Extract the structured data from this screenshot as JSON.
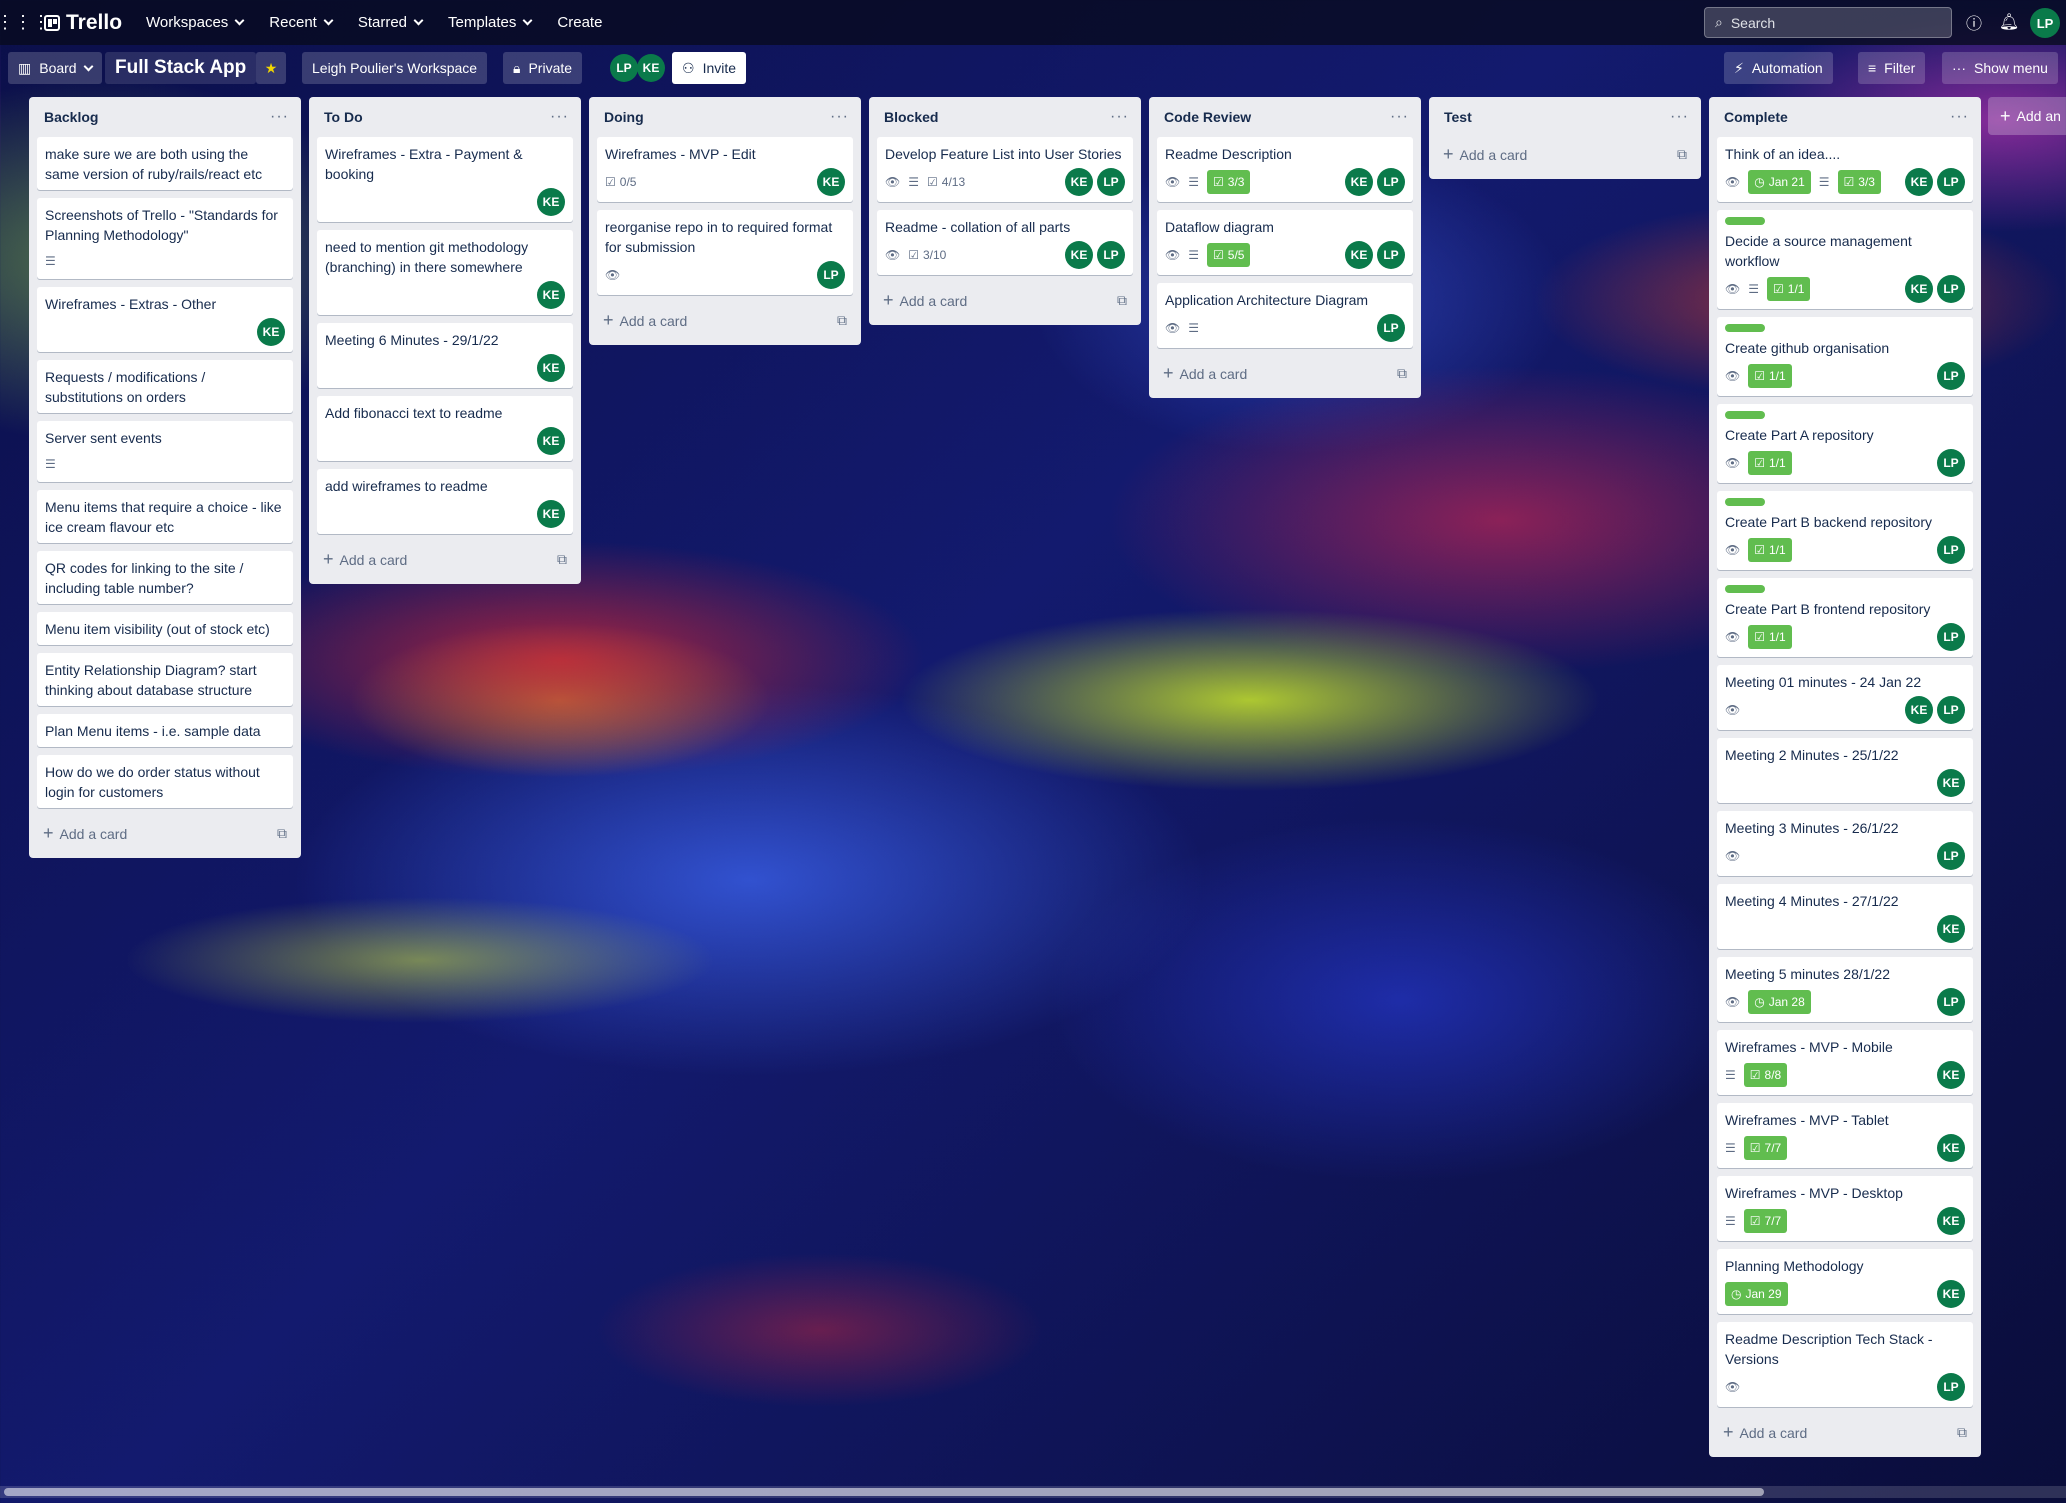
{
  "topbar": {
    "app_name": "Trello",
    "nav": [
      "Workspaces",
      "Recent",
      "Starred",
      "Templates"
    ],
    "create_label": "Create",
    "search_placeholder": "Search",
    "user_initials": "LP"
  },
  "board": {
    "view_label": "Board",
    "title": "Full Stack App",
    "workspace": "Leigh Poulier's Workspace",
    "visibility": "Private",
    "members": [
      "LP",
      "KE"
    ],
    "invite_label": "Invite",
    "automation_label": "Automation",
    "filter_label": "Filter",
    "show_menu_label": "Show menu",
    "add_list_label": "Add an"
  },
  "add_card_label": "Add a card",
  "lists": [
    {
      "title": "Backlog",
      "cards": [
        {
          "title": "make sure we are both using the same version of ruby/rails/react etc"
        },
        {
          "title": "Screenshots of Trello - \"Standards for Planning Methodology\"",
          "desc": true
        },
        {
          "title": "Wireframes - Extras - Other",
          "members": [
            "KE"
          ]
        },
        {
          "title": "Requests / modifications / substitutions on orders"
        },
        {
          "title": "Server sent events",
          "desc": true
        },
        {
          "title": "Menu items that require a choice - like ice cream flavour etc"
        },
        {
          "title": "QR codes for linking to the site / including table number?"
        },
        {
          "title": "Menu item visibility (out of stock etc)"
        },
        {
          "title": "Entity Relationship Diagram? start thinking about database structure"
        },
        {
          "title": "Plan Menu items - i.e. sample data"
        },
        {
          "title": "How do we do order status without login for customers"
        }
      ]
    },
    {
      "title": "To Do",
      "cards": [
        {
          "title": "Wireframes - Extra - Payment & booking",
          "members": [
            "KE"
          ]
        },
        {
          "title": "need to mention git methodology (branching) in there somewhere",
          "members": [
            "KE"
          ]
        },
        {
          "title": "Meeting 6 Minutes - 29/1/22",
          "members": [
            "KE"
          ]
        },
        {
          "title": "Add fibonacci text to readme",
          "members": [
            "KE"
          ]
        },
        {
          "title": "add wireframes to readme",
          "members": [
            "KE"
          ]
        }
      ]
    },
    {
      "title": "Doing",
      "cards": [
        {
          "title": "Wireframes - MVP - Edit",
          "checklist": "0/5",
          "members": [
            "KE"
          ]
        },
        {
          "title": "reorganise repo in to required format for submission",
          "watch": true,
          "members": [
            "LP"
          ]
        }
      ]
    },
    {
      "title": "Blocked",
      "cards": [
        {
          "title": "Develop Feature List into User Stories",
          "watch": true,
          "desc": true,
          "checklist": "4/13",
          "members": [
            "KE",
            "LP"
          ]
        },
        {
          "title": "Readme - collation of all parts",
          "watch": true,
          "checklist": "3/10",
          "members": [
            "KE",
            "LP"
          ]
        }
      ]
    },
    {
      "title": "Code Review",
      "cards": [
        {
          "title": "Readme Description",
          "watch": true,
          "desc": true,
          "checklist_done": "3/3",
          "members": [
            "KE",
            "LP"
          ]
        },
        {
          "title": "Dataflow diagram",
          "watch": true,
          "desc": true,
          "checklist_done": "5/5",
          "members": [
            "KE",
            "LP"
          ]
        },
        {
          "title": "Application Architecture Diagram",
          "watch": true,
          "desc": true,
          "members": [
            "LP"
          ]
        }
      ]
    },
    {
      "title": "Test",
      "cards": []
    },
    {
      "title": "Complete",
      "cards": [
        {
          "title": "Think of an idea....",
          "watch": true,
          "due": "Jan 21",
          "desc": true,
          "checklist_done": "3/3",
          "members": [
            "KE",
            "LP"
          ]
        },
        {
          "title": "Decide a source management workflow",
          "label": true,
          "watch": true,
          "desc": true,
          "checklist_done": "1/1",
          "members": [
            "KE",
            "LP"
          ]
        },
        {
          "title": "Create github organisation",
          "label": true,
          "watch": true,
          "checklist_done": "1/1",
          "members": [
            "LP"
          ]
        },
        {
          "title": "Create Part A repository",
          "label": true,
          "watch": true,
          "checklist_done": "1/1",
          "members": [
            "LP"
          ]
        },
        {
          "title": "Create Part B backend repository",
          "label": true,
          "watch": true,
          "checklist_done": "1/1",
          "members": [
            "LP"
          ]
        },
        {
          "title": "Create Part B frontend repository",
          "label": true,
          "watch": true,
          "checklist_done": "1/1",
          "members": [
            "LP"
          ]
        },
        {
          "title": "Meeting 01 minutes - 24 Jan 22",
          "watch": true,
          "members": [
            "KE",
            "LP"
          ]
        },
        {
          "title": "Meeting 2 Minutes - 25/1/22",
          "members": [
            "KE"
          ]
        },
        {
          "title": "Meeting 3 Minutes - 26/1/22",
          "watch": true,
          "members": [
            "LP"
          ]
        },
        {
          "title": "Meeting 4 Minutes - 27/1/22",
          "members": [
            "KE"
          ]
        },
        {
          "title": "Meeting 5 minutes 28/1/22",
          "watch": true,
          "due": "Jan 28",
          "members": [
            "LP"
          ]
        },
        {
          "title": "Wireframes - MVP - Mobile",
          "desc": true,
          "checklist_done": "8/8",
          "members": [
            "KE"
          ]
        },
        {
          "title": "Wireframes - MVP - Tablet",
          "desc": true,
          "checklist_done": "7/7",
          "members": [
            "KE"
          ]
        },
        {
          "title": "Wireframes - MVP - Desktop",
          "desc": true,
          "checklist_done": "7/7",
          "members": [
            "KE"
          ]
        },
        {
          "title": "Planning Methodology",
          "due": "Jan 29",
          "members": [
            "KE"
          ]
        },
        {
          "title": "Readme Description Tech Stack - Versions",
          "watch": true,
          "members": [
            "LP"
          ]
        }
      ]
    }
  ],
  "colors": {
    "label_green": "#61bd4f",
    "avatar_green": "#0a7a4a",
    "list_bg": "#ebecf0"
  }
}
